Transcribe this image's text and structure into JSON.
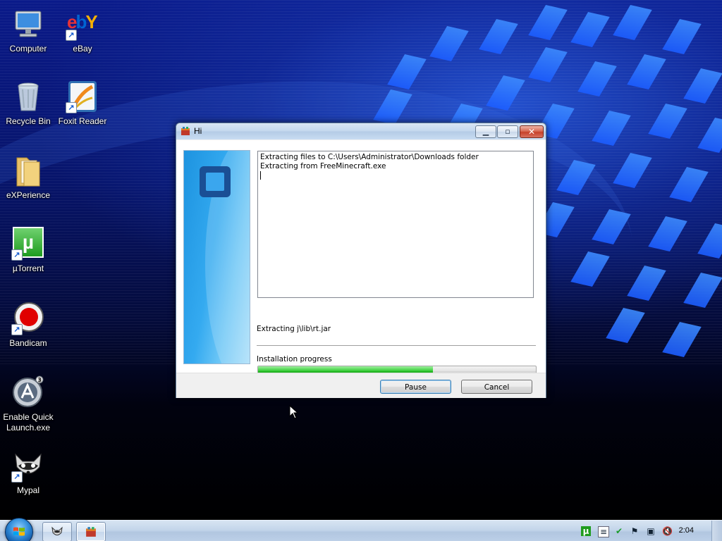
{
  "desktop": {
    "icons": [
      {
        "label": "Computer",
        "icon": "computer-icon"
      },
      {
        "label": "eBay",
        "icon": "ebay-icon",
        "logo_text": "ebY"
      },
      {
        "label": "Recycle Bin",
        "icon": "recycle-bin-icon"
      },
      {
        "label": "Foxit Reader",
        "icon": "foxit-reader-icon"
      },
      {
        "label": "eXPerience",
        "icon": "folder-icon"
      },
      {
        "label": "µTorrent",
        "icon": "utorrent-icon",
        "logo_text": "µ"
      },
      {
        "label": "Bandicam",
        "icon": "bandicam-icon"
      },
      {
        "label": "Enable Quick Launch.exe",
        "icon": "quick-launch-icon"
      },
      {
        "label": "Mypal",
        "icon": "mypal-icon"
      }
    ]
  },
  "dialog": {
    "title": "Hi",
    "log_lines": [
      "Extracting files to C:\\Users\\Administrator\\Downloads folder",
      "Extracting from FreeMinecraft.exe"
    ],
    "status_text": "Extracting j\\lib\\rt.jar",
    "progress_label": "Installation progress",
    "progress_fraction": 0.63,
    "buttons": {
      "pause": "Pause",
      "cancel": "Cancel"
    },
    "caption": {
      "minimize": "▁",
      "maximize": "▫",
      "close": "✕"
    }
  },
  "taskbar": {
    "clock": "2:04",
    "tray_icons": [
      "utorrent-tray-icon",
      "document-tray-icon",
      "security-tray-icon",
      "action-center-flag-icon",
      "network-icon",
      "volume-muted-icon"
    ]
  },
  "colors": {
    "progress_fill": "#22b822",
    "wallpaper": "#0a1a8a",
    "close_button": "#c7412a"
  }
}
